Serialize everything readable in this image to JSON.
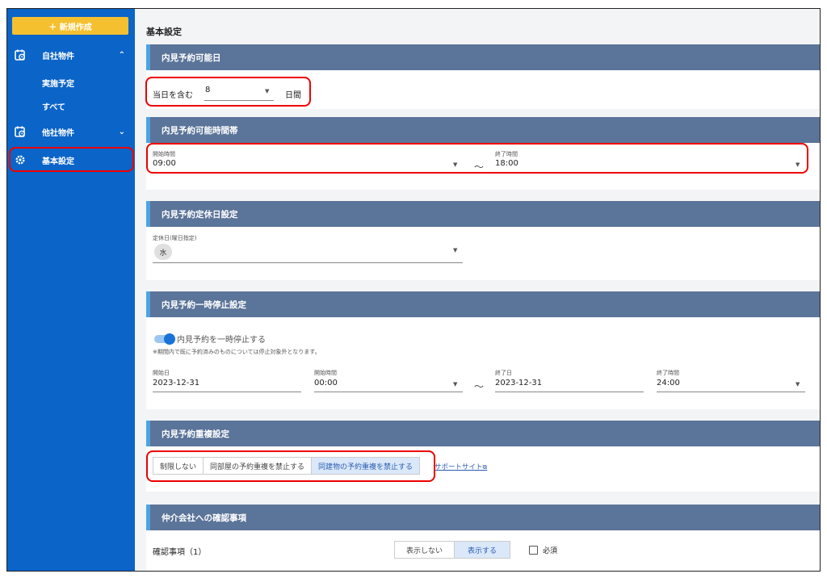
{
  "sidebar": {
    "new_button": "＋ 新規作成",
    "items": [
      {
        "label": "自社物件",
        "chevron": "⌃"
      },
      {
        "label": "実施予定"
      },
      {
        "label": "すべて"
      },
      {
        "label": "他社物件",
        "chevron": "⌄"
      },
      {
        "label": "基本設定"
      }
    ]
  },
  "page_title": "基本設定",
  "sections": {
    "available_days": {
      "header": "内見予約可能日",
      "prefix": "当日を含む",
      "value": "8",
      "suffix": "日間"
    },
    "time_range": {
      "header": "内見予約可能時間帯",
      "start_label": "開始時間",
      "start_value": "09:00",
      "separator": "～",
      "end_label": "終了時間",
      "end_value": "18:00"
    },
    "holidays": {
      "header": "内見予約定休日設定",
      "label": "定休日(曜日指定)",
      "chip": "水"
    },
    "pause": {
      "header": "内見予約一時停止設定",
      "toggle_label": "内見予約を一時停止する",
      "note": "※期間内で既に予約済みのものについては停止対象外となります。",
      "start_date_label": "開始日",
      "start_date": "2023-12-31",
      "start_time_label": "開始時間",
      "start_time": "00:00",
      "separator": "～",
      "end_date_label": "終了日",
      "end_date": "2023-12-31",
      "end_time_label": "終了時間",
      "end_time": "24:00"
    },
    "duplicate": {
      "header": "内見予約重複設定",
      "options": [
        "制限しない",
        "同部屋の予約重複を禁止する",
        "同建物の予約重複を禁止する"
      ],
      "selected_index": 2,
      "support_link": "サポートサイト",
      "link_icon": "external-link-icon"
    },
    "confirm": {
      "header": "仲介会社への確認事項",
      "item_label": "確認事項（1）",
      "options": [
        "表示しない",
        "表示する"
      ],
      "selected_index": 1,
      "required_label": "必須"
    }
  },
  "colors": {
    "sidebar": "#0b64c8",
    "new_button": "#f5c02f",
    "section_header": "#5b7499",
    "highlight": "#e00000"
  }
}
